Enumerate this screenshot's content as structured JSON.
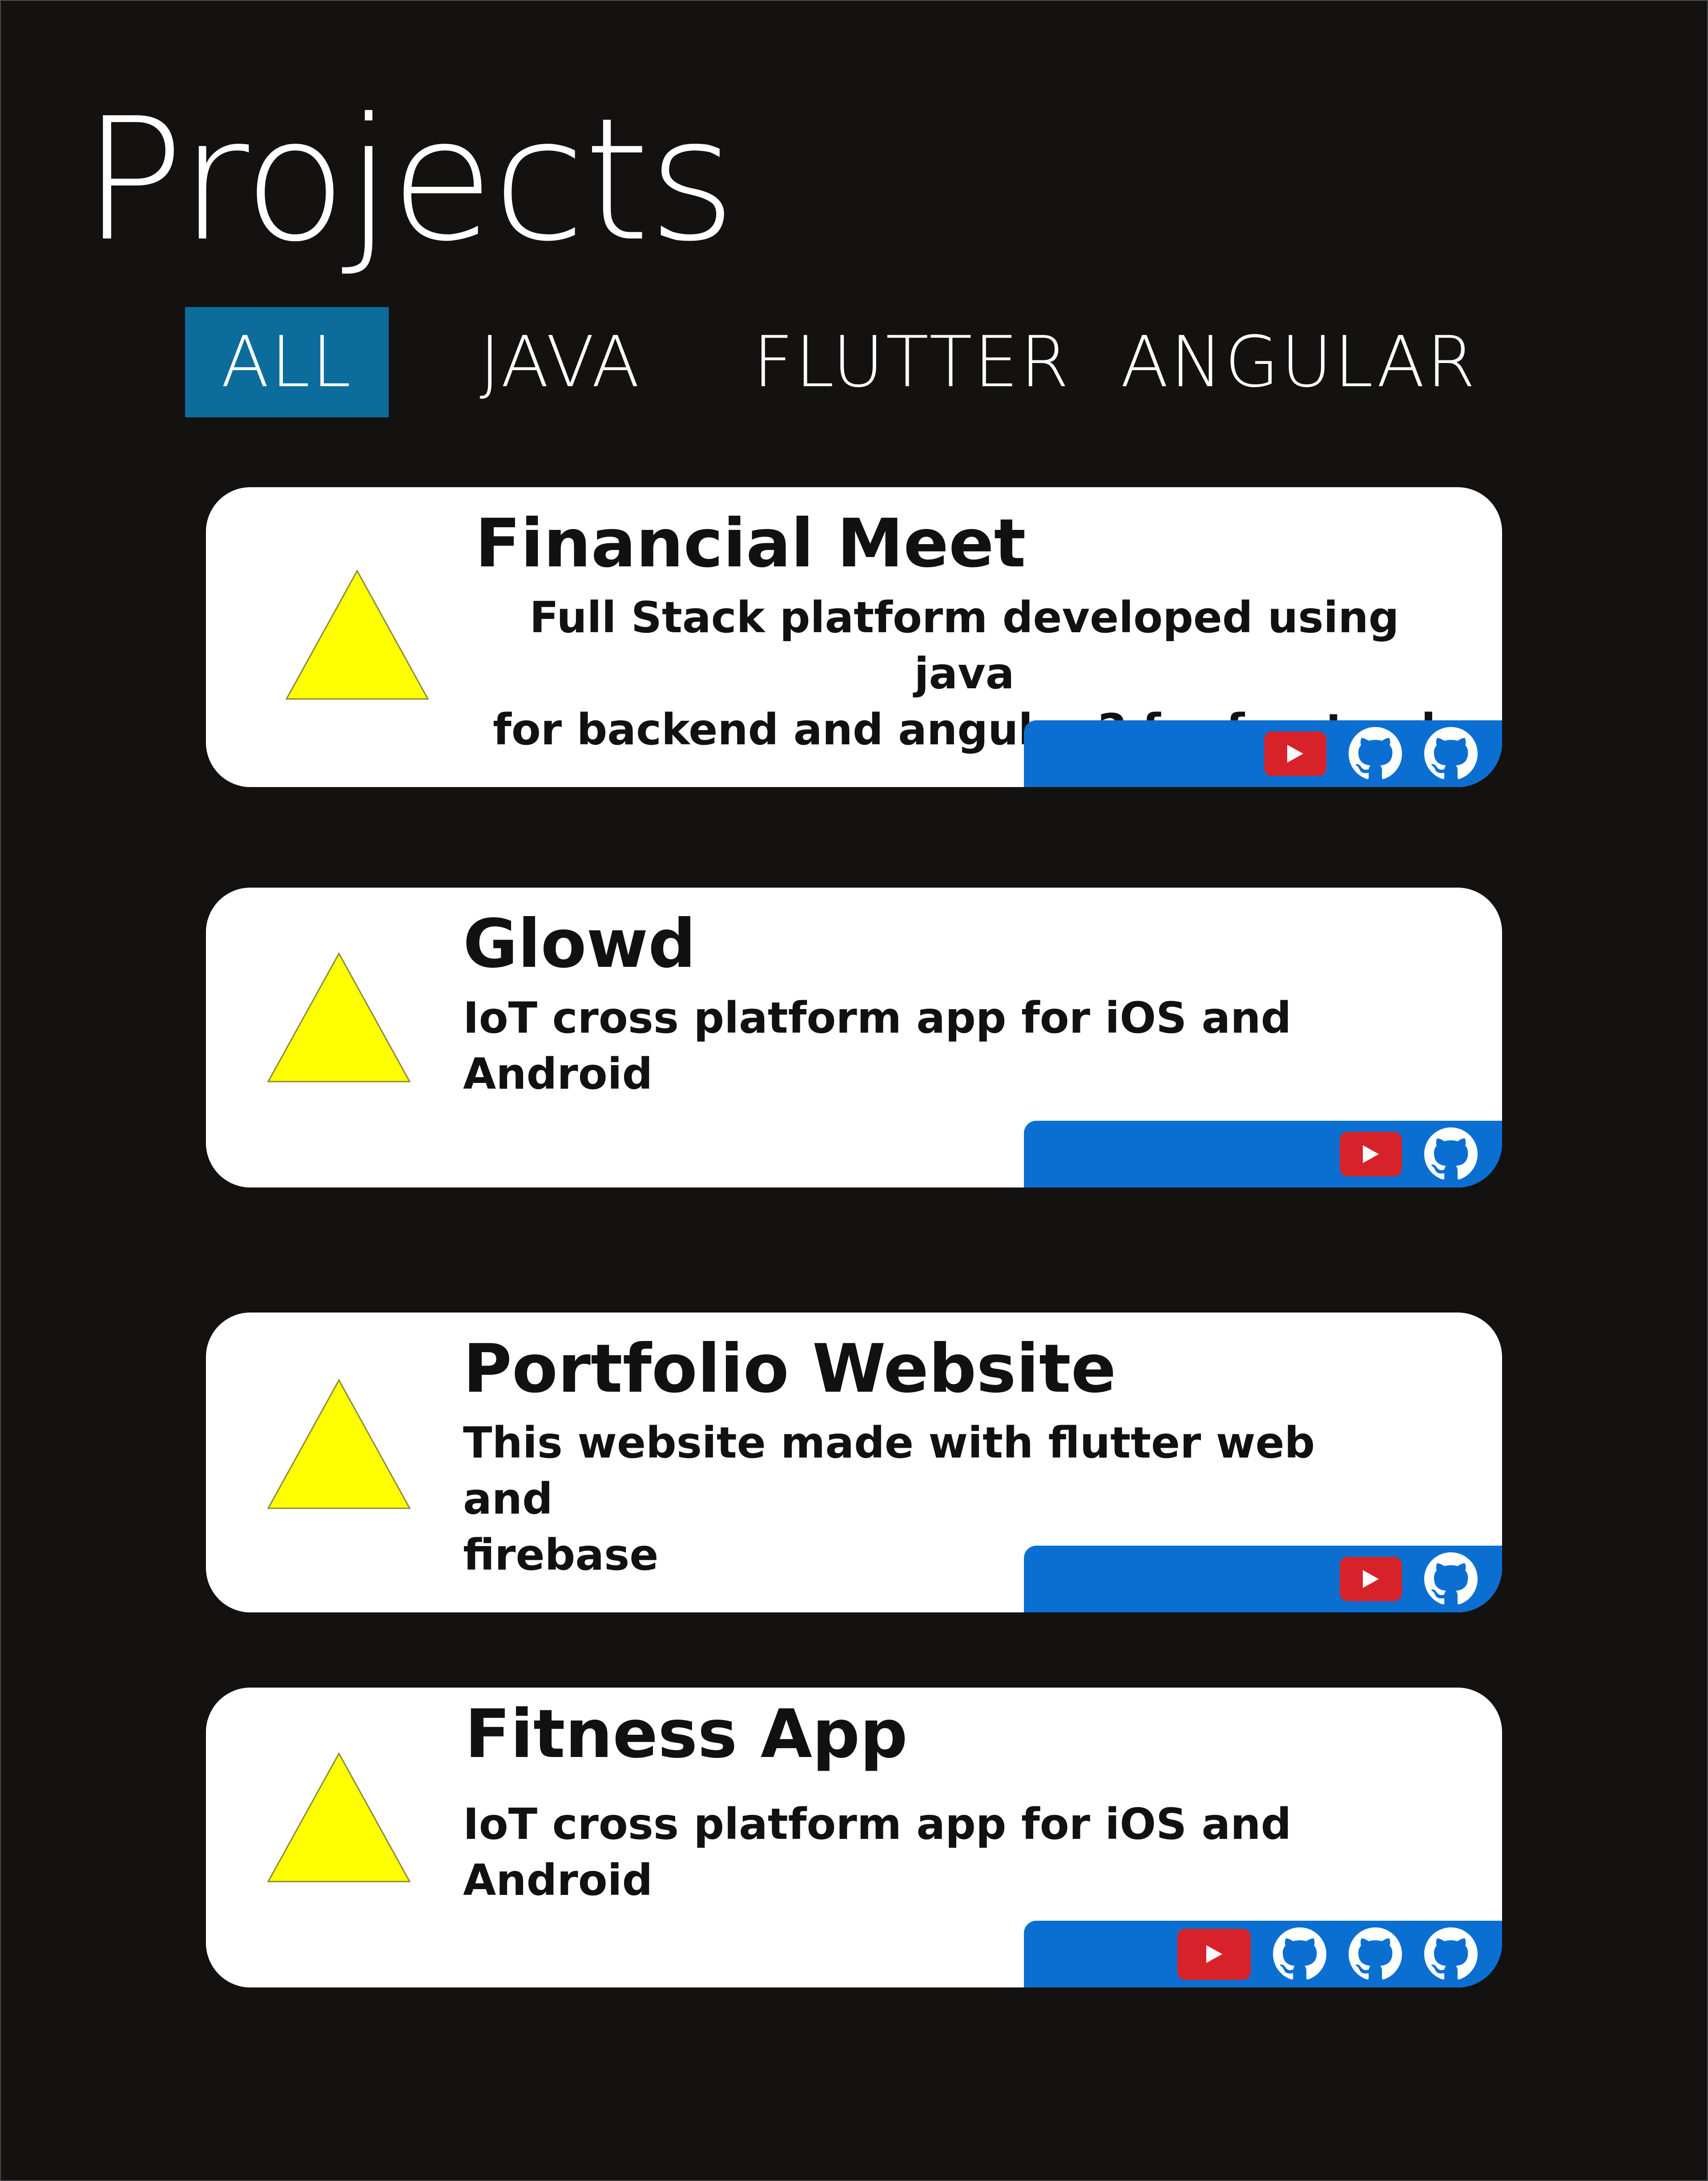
{
  "page": {
    "title": "Projects"
  },
  "filters": {
    "tabs": [
      {
        "label": "ALL",
        "active": true
      },
      {
        "label": "JAVA",
        "active": false
      },
      {
        "label": "FLUTTER",
        "active": false
      },
      {
        "label": "ANGULAR",
        "active": false
      }
    ]
  },
  "colors": {
    "background": "#141111",
    "active_tab": "#0c6c9c",
    "card": "#ffffff",
    "link_bar": "#0b6fd1",
    "youtube": "#d8222a",
    "thumbnail": "#ffff00"
  },
  "projects": [
    {
      "title": "Financial Meet",
      "description_line1": "Full Stack platform developed using java",
      "description_line2": "for backend and angular 2 for frontend",
      "thumbnail_icon": "triangle-placeholder",
      "links": [
        "youtube-icon",
        "github-icon",
        "github-icon"
      ]
    },
    {
      "title": "Glowd",
      "description_line1": "IoT cross platform app for iOS and Android",
      "thumbnail_icon": "triangle-placeholder",
      "links": [
        "youtube-icon",
        "github-icon"
      ]
    },
    {
      "title": "Portfolio Website",
      "description_line1": "This website made with flutter web and",
      "description_line2": "firebase",
      "thumbnail_icon": "triangle-placeholder",
      "links": [
        "youtube-icon",
        "github-icon"
      ]
    },
    {
      "title": "Fitness App",
      "description_line1": "IoT cross platform app for iOS and Android",
      "thumbnail_icon": "triangle-placeholder",
      "links": [
        "youtube-icon",
        "github-icon",
        "github-icon",
        "github-icon"
      ]
    }
  ]
}
